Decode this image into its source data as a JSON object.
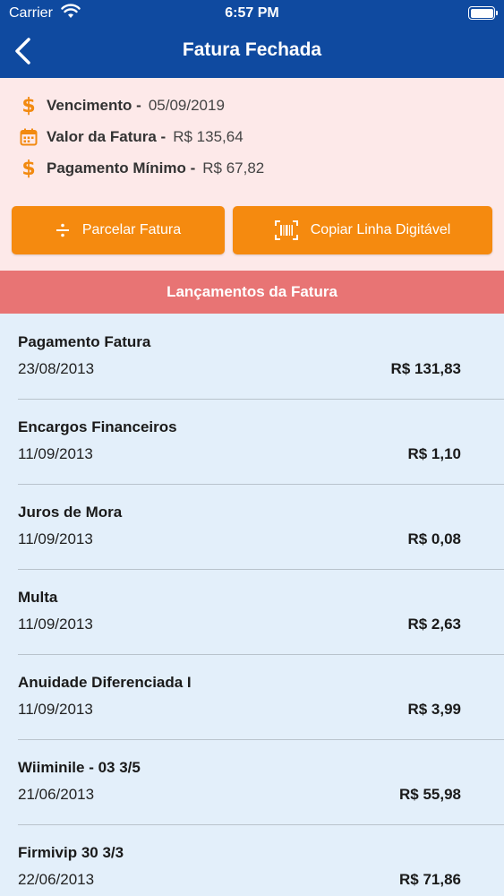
{
  "status_bar": {
    "carrier": "Carrier",
    "time": "6:57 PM"
  },
  "header": {
    "title": "Fatura Fechada",
    "back_icon": "chevron-left-icon"
  },
  "summary": {
    "vencimento_label": "Vencimento -",
    "vencimento_value": "05/09/2019",
    "valor_label": "Valor da Fatura -",
    "valor_value": "R$ 135,64",
    "minimo_label": "Pagamento Mínimo -",
    "minimo_value": "R$ 67,82"
  },
  "actions": {
    "parcelar_label": "Parcelar Fatura",
    "copiar_label": "Copiar Linha Digitável"
  },
  "section": {
    "title": "Lançamentos da Fatura"
  },
  "transactions": [
    {
      "name": "Pagamento Fatura",
      "date": "23/08/2013",
      "amount": "R$ 131,83"
    },
    {
      "name": "Encargos Financeiros",
      "date": "11/09/2013",
      "amount": "R$ 1,10"
    },
    {
      "name": "Juros de Mora",
      "date": "11/09/2013",
      "amount": "R$ 0,08"
    },
    {
      "name": "Multa",
      "date": "11/09/2013",
      "amount": "R$ 2,63"
    },
    {
      "name": "Anuidade Diferenciada I",
      "date": "11/09/2013",
      "amount": "R$ 3,99"
    },
    {
      "name": "Wiiminile - 03 3/5",
      "date": "21/06/2013",
      "amount": "R$ 55,98"
    },
    {
      "name": "Firmivip 30 3/3",
      "date": "22/06/2013",
      "amount": "R$ 71,86"
    }
  ],
  "colors": {
    "header_bg": "#0f4aa0",
    "summary_bg": "#fde9e9",
    "accent_orange": "#f58a0f",
    "section_bg": "#e87474",
    "list_bg": "#e3effa"
  }
}
